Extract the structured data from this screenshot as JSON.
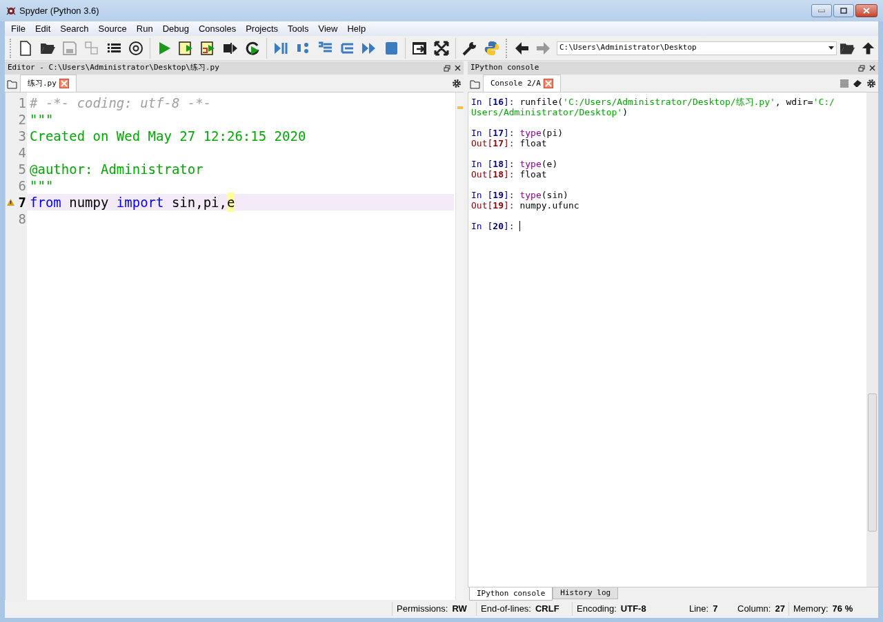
{
  "window": {
    "title": "Spyder (Python 3.6)"
  },
  "menu": [
    "File",
    "Edit",
    "Search",
    "Source",
    "Run",
    "Debug",
    "Consoles",
    "Projects",
    "Tools",
    "View",
    "Help"
  ],
  "path_field": {
    "value": "C:\\Users\\Administrator\\Desktop"
  },
  "editor": {
    "title": "Editor - C:\\Users\\Administrator\\Desktop\\练习.py",
    "tabs": [
      {
        "label": "练习.py",
        "selected": true
      }
    ],
    "lines": [
      {
        "number": "1",
        "current": false,
        "warning": false,
        "tokens": [
          {
            "text": "# -*- coding: utf-8 -*-",
            "kind": "comment"
          }
        ]
      },
      {
        "number": "2",
        "current": false,
        "warning": false,
        "tokens": [
          {
            "text": "\"\"\"",
            "kind": "string"
          }
        ]
      },
      {
        "number": "3",
        "current": false,
        "warning": false,
        "tokens": [
          {
            "text": "Created on Wed May 27 12:26:15 2020",
            "kind": "string"
          }
        ]
      },
      {
        "number": "4",
        "current": false,
        "warning": false
      },
      {
        "number": "5",
        "current": false,
        "warning": false,
        "tokens": [
          {
            "text": "@author: Administrator",
            "kind": "string"
          }
        ]
      },
      {
        "number": "6",
        "current": false,
        "warning": false,
        "tokens": [
          {
            "text": "\"\"\"",
            "kind": "string"
          }
        ]
      },
      {
        "number": "7",
        "current": true,
        "warning": true,
        "tokens": [
          {
            "text": "from",
            "kind": "keyword"
          },
          {
            "text": " numpy ",
            "kind": "plain"
          },
          {
            "text": "import",
            "kind": "keyword"
          },
          {
            "text": " sin,pi,",
            "kind": "plain"
          },
          {
            "text": "e",
            "kind": "match"
          }
        ]
      },
      {
        "number": "8",
        "current": false,
        "warning": false
      }
    ]
  },
  "console": {
    "title": "IPython console",
    "tabs": [
      {
        "label": "Console 2/A",
        "selected": true
      }
    ],
    "blocks": [
      {
        "lines": [
          {
            "tokens": [
              {
                "text": "In [**16**]: ",
                "kind": "in"
              },
              {
                "text": "runfile(",
                "kind": "plain"
              },
              {
                "text": "'C:/Users/Administrator/Desktop/练习.py'",
                "kind": "string"
              },
              {
                "text": ", wdir=",
                "kind": "plain"
              },
              {
                "text": "'C:/",
                "kind": "string"
              }
            ]
          },
          {
            "tokens": [
              {
                "text": "Users/Administrator/Desktop'",
                "kind": "string"
              },
              {
                "text": ")",
                "kind": "plain"
              }
            ]
          }
        ]
      },
      {
        "lines": [
          {
            "tokens": [
              {
                "text": "In [**17**]: ",
                "kind": "in"
              },
              {
                "text": "type",
                "kind": "builtin"
              },
              {
                "text": "(pi)",
                "kind": "plain"
              }
            ]
          },
          {
            "tokens": [
              {
                "text": "Out[**17**]: ",
                "kind": "out"
              },
              {
                "text": "float",
                "kind": "plain"
              }
            ]
          }
        ]
      },
      {
        "lines": [
          {
            "tokens": [
              {
                "text": "In [**18**]: ",
                "kind": "in"
              },
              {
                "text": "type",
                "kind": "builtin"
              },
              {
                "text": "(e)",
                "kind": "plain"
              }
            ]
          },
          {
            "tokens": [
              {
                "text": "Out[**18**]: ",
                "kind": "out"
              },
              {
                "text": "float",
                "kind": "plain"
              }
            ]
          }
        ]
      },
      {
        "lines": [
          {
            "tokens": [
              {
                "text": "In [**19**]: ",
                "kind": "in"
              },
              {
                "text": "type",
                "kind": "builtin"
              },
              {
                "text": "(sin)",
                "kind": "plain"
              }
            ]
          },
          {
            "tokens": [
              {
                "text": "Out[**19**]: ",
                "kind": "out"
              },
              {
                "text": "numpy.ufunc",
                "kind": "plain"
              }
            ]
          }
        ]
      },
      {
        "lines": [
          {
            "tokens": [
              {
                "text": "In [**20**]: ",
                "kind": "in"
              },
              {
                "kind": "cursor"
              }
            ]
          }
        ]
      }
    ],
    "bottom_tabs": [
      {
        "label": "IPython console",
        "selected": true
      },
      {
        "label": "History log",
        "selected": false
      }
    ]
  },
  "status_bar": [
    {
      "label": "Permissions:",
      "value": "RW"
    },
    {
      "label": "End-of-lines:",
      "value": "CRLF"
    },
    {
      "label": "Encoding:",
      "value": "UTF-8"
    },
    {
      "label": "Line:",
      "value": "7"
    },
    {
      "label": "Column:",
      "value": "27"
    },
    {
      "label": "Memory:",
      "value": "76 %"
    }
  ]
}
